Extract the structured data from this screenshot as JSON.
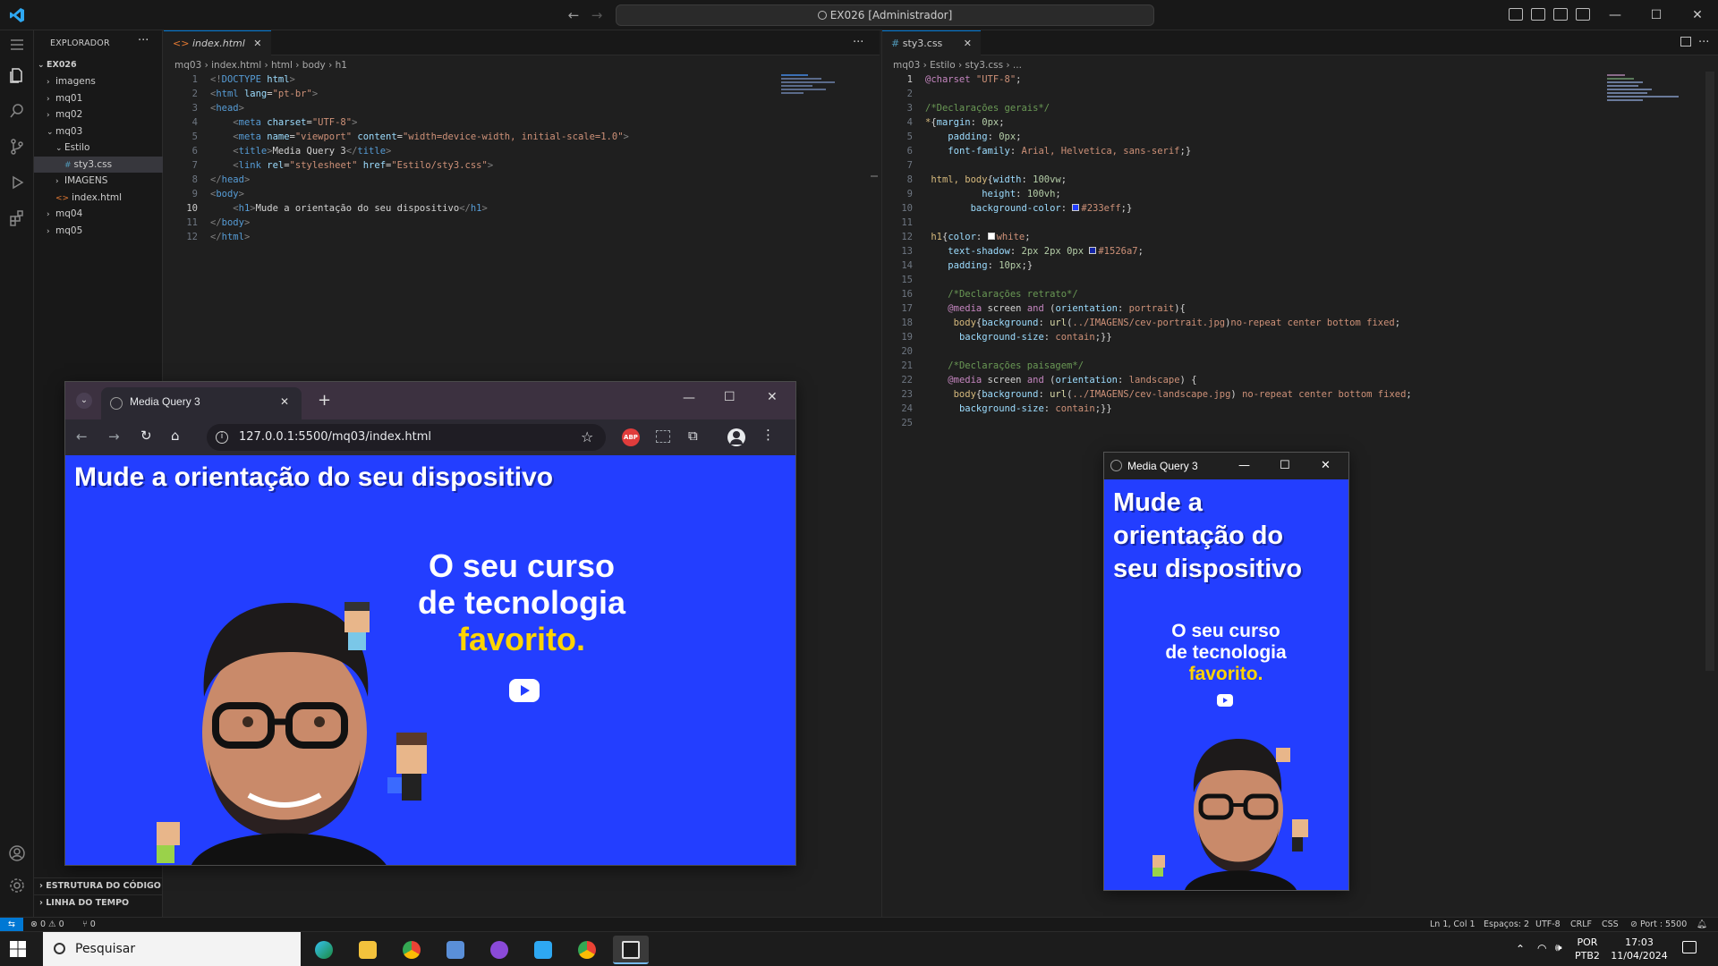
{
  "titlebar": {
    "command_center": "EX026 [Administrador]"
  },
  "sidebar": {
    "title": "EXPLORADOR",
    "root": "EX026",
    "items": [
      {
        "label": "imagens",
        "level": 1,
        "kind": "folder",
        "open": false
      },
      {
        "label": "mq01",
        "level": 1,
        "kind": "folder",
        "open": false
      },
      {
        "label": "mq02",
        "level": 1,
        "kind": "folder",
        "open": false
      },
      {
        "label": "mq03",
        "level": 1,
        "kind": "folder",
        "open": true
      },
      {
        "label": "Estilo",
        "level": 2,
        "kind": "folder",
        "open": true
      },
      {
        "label": "sty3.css",
        "level": 3,
        "kind": "css",
        "selected": true
      },
      {
        "label": "IMAGENS",
        "level": 2,
        "kind": "folder",
        "open": false
      },
      {
        "label": "index.html",
        "level": 2,
        "kind": "html"
      },
      {
        "label": "mq04",
        "level": 1,
        "kind": "folder",
        "open": false
      },
      {
        "label": "mq05",
        "level": 1,
        "kind": "folder",
        "open": false
      }
    ],
    "outline_label": "ESTRUTURA DO CÓDIGO",
    "timeline_label": "LINHA DO TEMPO"
  },
  "editor_html": {
    "tab_label": "index.html",
    "breadcrumbs": [
      "mq03",
      "index.html",
      "html",
      "body",
      "h1"
    ],
    "current_line": 10,
    "lines": [
      [
        [
          "t-punct",
          "<!"
        ],
        [
          "t-tag",
          "DOCTYPE"
        ],
        [
          "t-attr",
          " html"
        ],
        [
          "t-punct",
          ">"
        ]
      ],
      [
        [
          "t-punct",
          "<"
        ],
        [
          "t-tag",
          "html"
        ],
        [
          "t-attr",
          " lang"
        ],
        [
          "t-plain",
          "="
        ],
        [
          "t-str",
          "\"pt-br\""
        ],
        [
          "t-punct",
          ">"
        ]
      ],
      [
        [
          "t-punct",
          "<"
        ],
        [
          "t-tag",
          "head"
        ],
        [
          "t-punct",
          ">"
        ]
      ],
      [
        [
          "t-plain",
          "    "
        ],
        [
          "t-punct",
          "<"
        ],
        [
          "t-tag",
          "meta"
        ],
        [
          "t-attr",
          " charset"
        ],
        [
          "t-plain",
          "="
        ],
        [
          "t-str",
          "\"UTF-8\""
        ],
        [
          "t-punct",
          ">"
        ]
      ],
      [
        [
          "t-plain",
          "    "
        ],
        [
          "t-punct",
          "<"
        ],
        [
          "t-tag",
          "meta"
        ],
        [
          "t-attr",
          " name"
        ],
        [
          "t-plain",
          "="
        ],
        [
          "t-str",
          "\"viewport\""
        ],
        [
          "t-attr",
          " content"
        ],
        [
          "t-plain",
          "="
        ],
        [
          "t-str",
          "\"width=device-width, initial-scale=1.0\""
        ],
        [
          "t-punct",
          ">"
        ]
      ],
      [
        [
          "t-plain",
          "    "
        ],
        [
          "t-punct",
          "<"
        ],
        [
          "t-tag",
          "title"
        ],
        [
          "t-punct",
          ">"
        ],
        [
          "t-text",
          "Media Query 3"
        ],
        [
          "t-punct",
          "</"
        ],
        [
          "t-tag",
          "title"
        ],
        [
          "t-punct",
          ">"
        ]
      ],
      [
        [
          "t-plain",
          "    "
        ],
        [
          "t-punct",
          "<"
        ],
        [
          "t-tag",
          "link"
        ],
        [
          "t-attr",
          " rel"
        ],
        [
          "t-plain",
          "="
        ],
        [
          "t-str",
          "\"stylesheet\""
        ],
        [
          "t-attr",
          " href"
        ],
        [
          "t-plain",
          "="
        ],
        [
          "t-str",
          "\"Estilo/sty3.css\""
        ],
        [
          "t-punct",
          ">"
        ]
      ],
      [
        [
          "t-punct",
          "</"
        ],
        [
          "t-tag",
          "head"
        ],
        [
          "t-punct",
          ">"
        ]
      ],
      [
        [
          "t-punct",
          "<"
        ],
        [
          "t-tag",
          "body"
        ],
        [
          "t-punct",
          ">"
        ]
      ],
      [
        [
          "t-plain",
          "    "
        ],
        [
          "t-punct",
          "<"
        ],
        [
          "t-tag",
          "h1"
        ],
        [
          "t-punct",
          ">"
        ],
        [
          "t-text",
          "Mude a orientação do seu dispositivo"
        ],
        [
          "t-punct",
          "</"
        ],
        [
          "t-tag",
          "h1"
        ],
        [
          "t-punct",
          ">"
        ]
      ],
      [
        [
          "t-punct",
          "</"
        ],
        [
          "t-tag",
          "body"
        ],
        [
          "t-punct",
          ">"
        ]
      ],
      [
        [
          "t-punct",
          "</"
        ],
        [
          "t-tag",
          "html"
        ],
        [
          "t-punct",
          ">"
        ]
      ]
    ]
  },
  "editor_css": {
    "tab_label": "sty3.css",
    "breadcrumbs": [
      "mq03",
      "Estilo",
      "sty3.css",
      "..."
    ],
    "current_line": 1,
    "lines": [
      [
        [
          "t-kw",
          "@charset"
        ],
        [
          "t-str",
          " \"UTF-8\""
        ],
        [
          "t-plain",
          ";"
        ]
      ],
      [],
      [
        [
          "t-com",
          "/*Declarações gerais*/"
        ]
      ],
      [
        [
          "t-sel",
          "*"
        ],
        [
          "t-plain",
          "{"
        ],
        [
          "t-prop",
          "margin"
        ],
        [
          "t-plain",
          ": "
        ],
        [
          "t-num",
          "0px"
        ],
        [
          "t-plain",
          ";"
        ]
      ],
      [
        [
          "t-plain",
          "    "
        ],
        [
          "t-prop",
          "padding"
        ],
        [
          "t-plain",
          ": "
        ],
        [
          "t-num",
          "0px"
        ],
        [
          "t-plain",
          ";"
        ]
      ],
      [
        [
          "t-plain",
          "    "
        ],
        [
          "t-prop",
          "font-family"
        ],
        [
          "t-plain",
          ": "
        ],
        [
          "t-val",
          "Arial, Helvetica, sans-serif"
        ],
        [
          "t-plain",
          ";}"
        ]
      ],
      [],
      [
        [
          "t-plain",
          " "
        ],
        [
          "t-sel",
          "html, body"
        ],
        [
          "t-plain",
          "{"
        ],
        [
          "t-prop",
          "width"
        ],
        [
          "t-plain",
          ": "
        ],
        [
          "t-num",
          "100vw"
        ],
        [
          "t-plain",
          ";"
        ]
      ],
      [
        [
          "t-plain",
          "          "
        ],
        [
          "t-prop",
          "height"
        ],
        [
          "t-plain",
          ": "
        ],
        [
          "t-num",
          "100vh"
        ],
        [
          "t-plain",
          ";"
        ]
      ],
      [
        [
          "t-plain",
          "        "
        ],
        [
          "t-prop",
          "background-color"
        ],
        [
          "t-plain",
          ": "
        ],
        [
          "swatch",
          "#233eff"
        ],
        [
          "t-val",
          "#233eff"
        ],
        [
          "t-plain",
          ";}"
        ]
      ],
      [],
      [
        [
          "t-plain",
          " "
        ],
        [
          "t-sel",
          "h1"
        ],
        [
          "t-plain",
          "{"
        ],
        [
          "t-prop",
          "color"
        ],
        [
          "t-plain",
          ": "
        ],
        [
          "swatch",
          "#ffffff"
        ],
        [
          "t-val",
          "white"
        ],
        [
          "t-plain",
          ";"
        ]
      ],
      [
        [
          "t-plain",
          "    "
        ],
        [
          "t-prop",
          "text-shadow"
        ],
        [
          "t-plain",
          ": "
        ],
        [
          "t-num",
          "2px 2px 0px "
        ],
        [
          "swatch",
          "#1526a7"
        ],
        [
          "t-val",
          "#1526a7"
        ],
        [
          "t-plain",
          ";"
        ]
      ],
      [
        [
          "t-plain",
          "    "
        ],
        [
          "t-prop",
          "padding"
        ],
        [
          "t-plain",
          ": "
        ],
        [
          "t-num",
          "10px"
        ],
        [
          "t-plain",
          ";}"
        ]
      ],
      [],
      [
        [
          "t-plain",
          "    "
        ],
        [
          "t-com",
          "/*Declarações retrato*/"
        ]
      ],
      [
        [
          "t-plain",
          "    "
        ],
        [
          "t-kw",
          "@media"
        ],
        [
          "t-plain",
          " screen "
        ],
        [
          "t-kw",
          "and"
        ],
        [
          "t-plain",
          " ("
        ],
        [
          "t-prop",
          "orientation"
        ],
        [
          "t-plain",
          ": "
        ],
        [
          "t-val",
          "portrait"
        ],
        [
          "t-plain",
          "){"
        ]
      ],
      [
        [
          "t-plain",
          "     "
        ],
        [
          "t-sel",
          "body"
        ],
        [
          "t-plain",
          "{"
        ],
        [
          "t-prop",
          "background"
        ],
        [
          "t-plain",
          ": "
        ],
        [
          "t-fn",
          "url"
        ],
        [
          "t-plain",
          "("
        ],
        [
          "t-val",
          "../IMAGENS/cev-portrait.jpg"
        ],
        [
          "t-plain",
          ")"
        ],
        [
          "t-val",
          "no-repeat center bottom fixed"
        ],
        [
          "t-plain",
          ";"
        ]
      ],
      [
        [
          "t-plain",
          "      "
        ],
        [
          "t-prop",
          "background-size"
        ],
        [
          "t-plain",
          ": "
        ],
        [
          "t-val",
          "contain"
        ],
        [
          "t-plain",
          ";}}"
        ]
      ],
      [],
      [
        [
          "t-plain",
          "    "
        ],
        [
          "t-com",
          "/*Declarações paisagem*/"
        ]
      ],
      [
        [
          "t-plain",
          "    "
        ],
        [
          "t-kw",
          "@media"
        ],
        [
          "t-plain",
          " screen "
        ],
        [
          "t-kw",
          "and"
        ],
        [
          "t-plain",
          " ("
        ],
        [
          "t-prop",
          "orientation"
        ],
        [
          "t-plain",
          ": "
        ],
        [
          "t-val",
          "landscape"
        ],
        [
          "t-plain",
          ") {"
        ]
      ],
      [
        [
          "t-plain",
          "     "
        ],
        [
          "t-sel",
          "body"
        ],
        [
          "t-plain",
          "{"
        ],
        [
          "t-prop",
          "background"
        ],
        [
          "t-plain",
          ": "
        ],
        [
          "t-fn",
          "url"
        ],
        [
          "t-plain",
          "("
        ],
        [
          "t-val",
          "../IMAGENS/cev-landscape.jpg"
        ],
        [
          "t-plain",
          ") "
        ],
        [
          "t-val",
          "no-repeat center bottom fixed"
        ],
        [
          "t-plain",
          ";"
        ]
      ],
      [
        [
          "t-plain",
          "      "
        ],
        [
          "t-prop",
          "background-size"
        ],
        [
          "t-plain",
          ": "
        ],
        [
          "t-val",
          "contain"
        ],
        [
          "t-plain",
          ";}}"
        ]
      ],
      []
    ]
  },
  "chrome_window": {
    "tab_title": "Media Query 3",
    "url": "127.0.0.1:5500/mq03/index.html",
    "abp_label": "ABP",
    "page_heading": "Mude a orientação do seu dispositivo",
    "promo": {
      "line1": "O seu curso",
      "line2": "de tecnologia",
      "line3": "favorito."
    }
  },
  "portrait_window": {
    "title": "Media Query 3",
    "page_heading": "Mude a orientação do seu dispositivo",
    "promo": {
      "line1": "O seu curso",
      "line2": "de tecnologia",
      "line3": "favorito."
    }
  },
  "statusbar": {
    "errors": "0",
    "warnings": "0",
    "ports": "0",
    "position": "Ln 1, Col 1",
    "spaces": "Espaços: 2",
    "encoding": "UTF-8",
    "eol": "CRLF",
    "language": "CSS",
    "port": "Port : 5500"
  },
  "taskbar": {
    "search_placeholder": "Pesquisar",
    "lang_line1": "POR",
    "lang_line2": "PTB2",
    "time": "17:03",
    "date": "11/04/2024"
  },
  "colors": {
    "page_bg": "#233eff",
    "h1_shadow": "#1526a7",
    "accent": "#0078d4"
  }
}
